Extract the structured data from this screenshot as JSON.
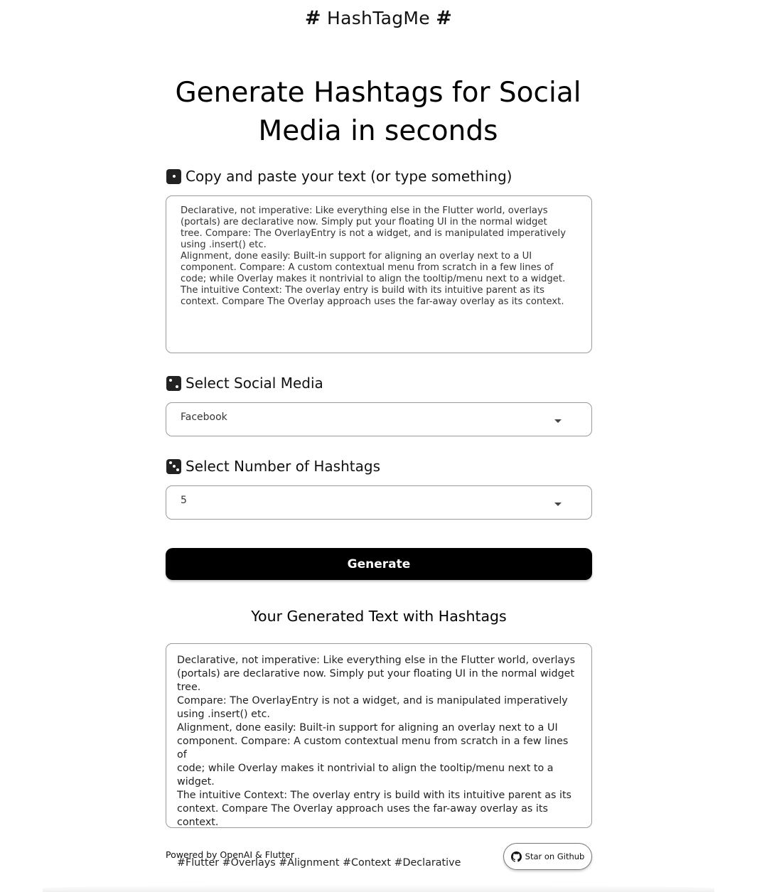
{
  "header": {
    "brand_hash_left": "#",
    "brand_name": "HashTagMe",
    "brand_hash_right": "#"
  },
  "main": {
    "headline": "Generate Hashtags for Social Media in seconds"
  },
  "step1": {
    "label": "Copy and paste your text (or type something)",
    "icon": "dice-one-icon",
    "text": "Declarative, not imperative: Like everything else in the Flutter world, overlays\n(portals) are declarative now. Simply put your floating UI in the normal widget\ntree. Compare: The OverlayEntry is not a widget, and is manipulated imperatively\nusing .insert() etc.\nAlignment, done easily: Built-in support for aligning an overlay next to a UI\ncomponent. Compare: A custom contextual menu from scratch in a few lines of\ncode; while Overlay makes it nontrivial to align the tooltip/menu next to a widget.\nThe intuitive Context: The overlay entry is build with its intuitive parent as its\ncontext. Compare The Overlay approach uses the far-away overlay as its context."
  },
  "step2": {
    "label": "Select Social Media",
    "icon": "dice-two-icon",
    "selected": "Facebook"
  },
  "step3": {
    "label": "Select Number of Hashtags",
    "icon": "dice-three-icon",
    "selected": "5"
  },
  "generate": {
    "label": "Generate"
  },
  "result": {
    "title": "Your Generated Text with Hashtags",
    "text": "Declarative, not imperative: Like everything else in the Flutter world, overlays\n(portals) are declarative now. Simply put your floating UI in the normal widget tree.\nCompare: The OverlayEntry is not a widget, and is manipulated imperatively\nusing .insert() etc.\nAlignment, done easily: Built-in support for aligning an overlay next to a UI\ncomponent. Compare: A custom contextual menu from scratch in a few lines of\ncode; while Overlay makes it nontrivial to align the tooltip/menu next to a widget.\nThe intuitive Context: The overlay entry is build with its intuitive parent as its\ncontext. Compare The Overlay approach uses the far-away overlay as its context.",
    "hashtags": "#Flutter #Overlays #Alignment #Context #Declarative"
  },
  "footer": {
    "credit": "Powered by OpenAI & Flutter",
    "star_label": "Star on Github",
    "star_icon": "github-icon"
  },
  "colors": {
    "primary_button": "#000000",
    "border": "#9a9a9a",
    "background": "#ffffff"
  }
}
